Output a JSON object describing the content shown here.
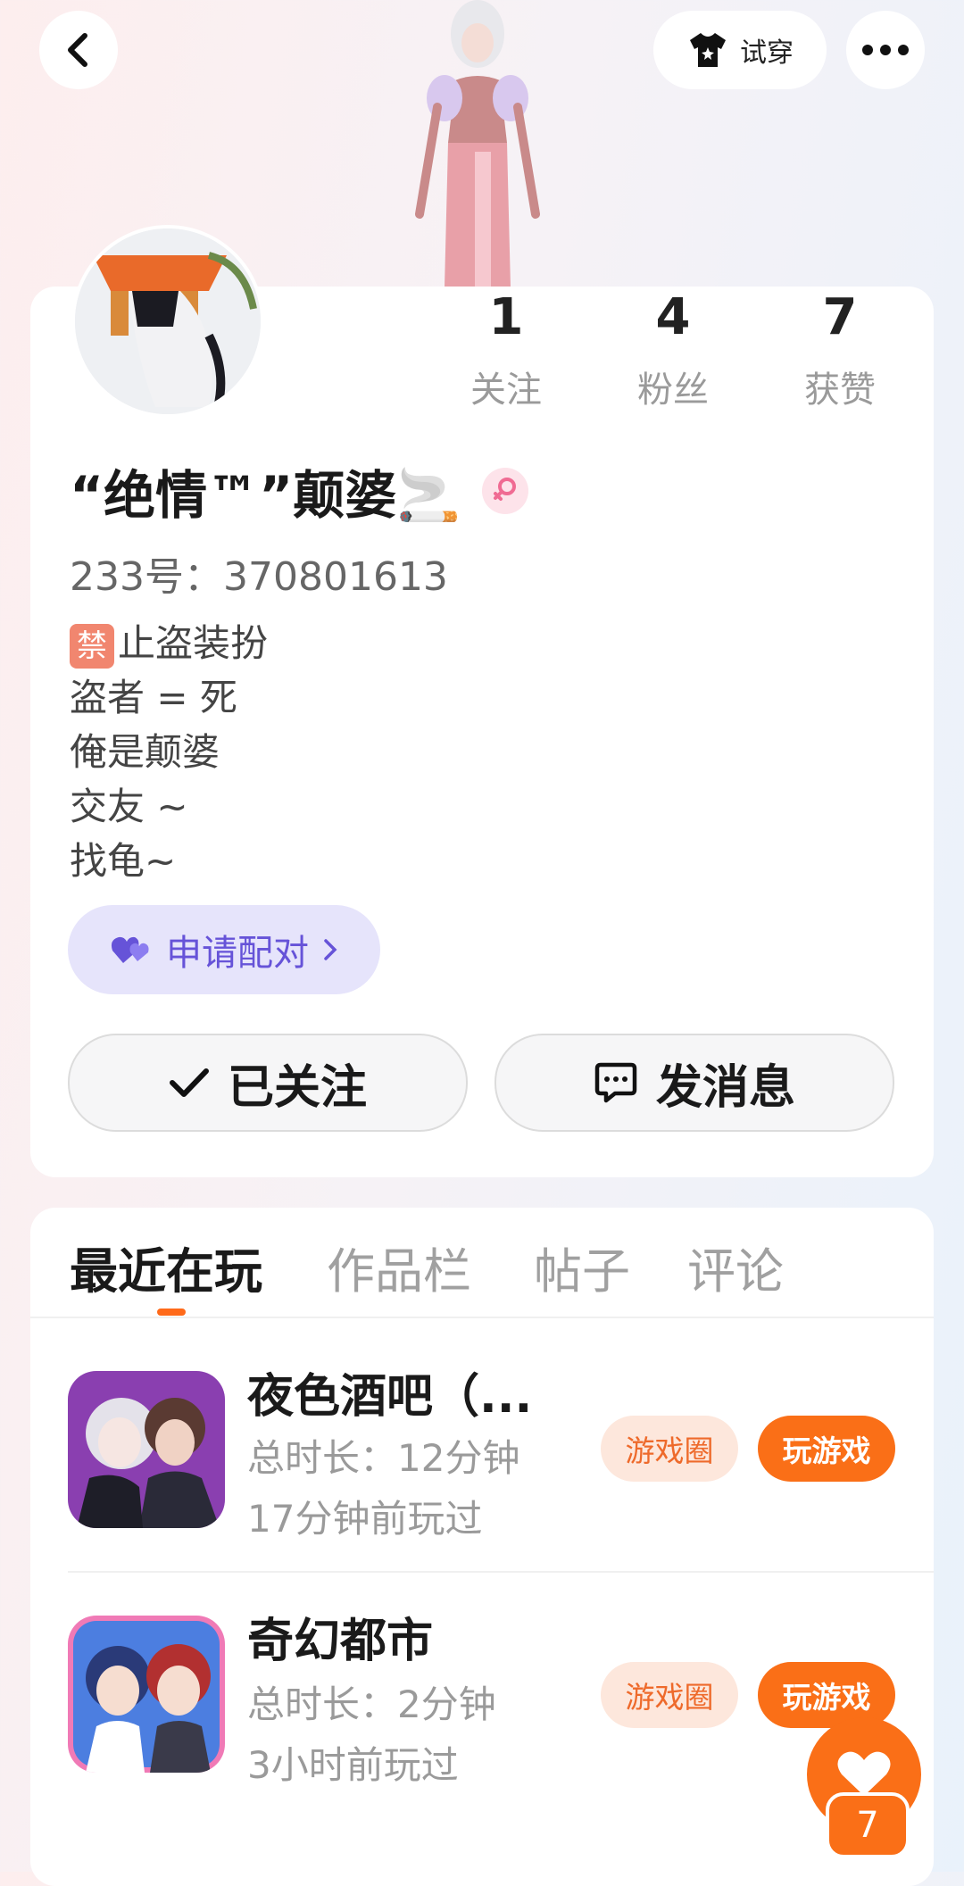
{
  "header": {
    "tryon_label": "试穿"
  },
  "stats": [
    {
      "value": "1",
      "label": "关注"
    },
    {
      "value": "4",
      "label": "粉丝"
    },
    {
      "value": "7",
      "label": "获赞"
    }
  ],
  "profile": {
    "nickname": "“绝情™”颠婆🚬",
    "id_line": "233号：370801613",
    "bio_first_rest": "止盗装扮",
    "bio_first_badge": "禁",
    "bio_lines": [
      "盗者 = 死",
      "俺是颠婆",
      "交友 ~",
      "找龟~"
    ],
    "pair_label": "申请配对"
  },
  "actions": {
    "follow_label": "已关注",
    "message_label": "发消息"
  },
  "tabs": [
    "最近在玩",
    "作品栏",
    "帖子",
    "评论"
  ],
  "games": [
    {
      "title": "夜色酒吧（...",
      "duration": "总时长：12分钟",
      "last_played": "17分钟前玩过",
      "circle_label": "游戏圈",
      "play_label": "玩游戏"
    },
    {
      "title": "奇幻都市",
      "duration": "总时长：2分钟",
      "last_played": "3小时前玩过",
      "circle_label": "游戏圈",
      "play_label": "玩游戏"
    }
  ],
  "likes": {
    "count": "7"
  },
  "colors": {
    "accent": "#fa6f17",
    "pair": "#6653d8",
    "pair_bg": "#e6e4fb"
  }
}
